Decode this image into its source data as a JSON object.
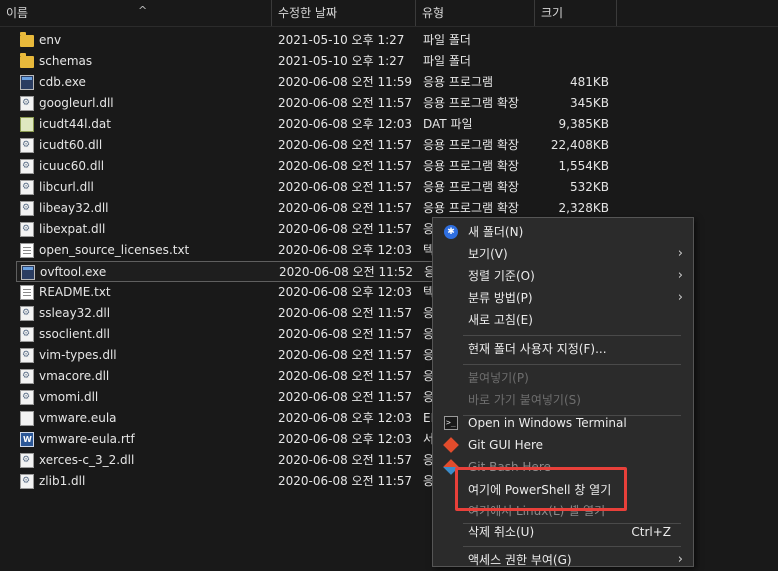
{
  "header": {
    "name": "이름",
    "date": "수정한 날짜",
    "type": "유형",
    "size": "크기",
    "sort_arrow": "^"
  },
  "files": [
    {
      "icon": "folder-icon",
      "kind": "folder",
      "name": "env",
      "date": "2021-05-10 오후 1:27",
      "type": "파일 폴더",
      "size": ""
    },
    {
      "icon": "folder-icon",
      "kind": "folder",
      "name": "schemas",
      "date": "2021-05-10 오후 1:27",
      "type": "파일 폴더",
      "size": ""
    },
    {
      "icon": "exe-icon",
      "kind": "exe",
      "name": "cdb.exe",
      "date": "2020-06-08 오전 11:59",
      "type": "응용 프로그램",
      "size": "481KB"
    },
    {
      "icon": "dll-icon",
      "kind": "dll",
      "name": "googleurl.dll",
      "date": "2020-06-08 오전 11:57",
      "type": "응용 프로그램 확장",
      "size": "345KB"
    },
    {
      "icon": "dat-icon",
      "kind": "dat",
      "name": "icudt44l.dat",
      "date": "2020-06-08 오후 12:03",
      "type": "DAT 파일",
      "size": "9,385KB"
    },
    {
      "icon": "dll-icon",
      "kind": "dll",
      "name": "icudt60.dll",
      "date": "2020-06-08 오전 11:57",
      "type": "응용 프로그램 확장",
      "size": "22,408KB"
    },
    {
      "icon": "dll-icon",
      "kind": "dll",
      "name": "icuuc60.dll",
      "date": "2020-06-08 오전 11:57",
      "type": "응용 프로그램 확장",
      "size": "1,554KB"
    },
    {
      "icon": "dll-icon",
      "kind": "dll",
      "name": "libcurl.dll",
      "date": "2020-06-08 오전 11:57",
      "type": "응용 프로그램 확장",
      "size": "532KB"
    },
    {
      "icon": "dll-icon",
      "kind": "dll",
      "name": "libeay32.dll",
      "date": "2020-06-08 오전 11:57",
      "type": "응용 프로그램 확장",
      "size": "2,328KB"
    },
    {
      "icon": "dll-icon",
      "kind": "dll",
      "name": "libexpat.dll",
      "date": "2020-06-08 오전 11:57",
      "type": "응",
      "size": ""
    },
    {
      "icon": "text-file-icon",
      "kind": "txt",
      "name": "open_source_licenses.txt",
      "date": "2020-06-08 오후 12:03",
      "type": "텍",
      "size": ""
    },
    {
      "icon": "exe-icon",
      "kind": "exe",
      "name": "ovftool.exe",
      "date": "2020-06-08 오전 11:52",
      "type": "응",
      "size": "",
      "selected": true
    },
    {
      "icon": "text-file-icon",
      "kind": "txt",
      "name": "README.txt",
      "date": "2020-06-08 오후 12:03",
      "type": "텍",
      "size": ""
    },
    {
      "icon": "dll-icon",
      "kind": "dll",
      "name": "ssleay32.dll",
      "date": "2020-06-08 오전 11:57",
      "type": "응",
      "size": ""
    },
    {
      "icon": "dll-icon",
      "kind": "dll",
      "name": "ssoclient.dll",
      "date": "2020-06-08 오전 11:57",
      "type": "응",
      "size": ""
    },
    {
      "icon": "dll-icon",
      "kind": "dll",
      "name": "vim-types.dll",
      "date": "2020-06-08 오전 11:57",
      "type": "응",
      "size": ""
    },
    {
      "icon": "dll-icon",
      "kind": "dll",
      "name": "vmacore.dll",
      "date": "2020-06-08 오전 11:57",
      "type": "응",
      "size": ""
    },
    {
      "icon": "dll-icon",
      "kind": "dll",
      "name": "vmomi.dll",
      "date": "2020-06-08 오전 11:57",
      "type": "응",
      "size": ""
    },
    {
      "icon": "file-icon",
      "kind": "file",
      "name": "vmware.eula",
      "date": "2020-06-08 오후 12:03",
      "type": "EL",
      "size": ""
    },
    {
      "icon": "rtf-icon",
      "kind": "rtf",
      "name": "vmware-eula.rtf",
      "date": "2020-06-08 오후 12:03",
      "type": "서",
      "size": ""
    },
    {
      "icon": "dll-icon",
      "kind": "dll",
      "name": "xerces-c_3_2.dll",
      "date": "2020-06-08 오전 11:57",
      "type": "응",
      "size": ""
    },
    {
      "icon": "dll-icon",
      "kind": "dll",
      "name": "zlib1.dll",
      "date": "2020-06-08 오전 11:57",
      "type": "응",
      "size": ""
    }
  ],
  "menu": {
    "new_folder": "새 폴더(N)",
    "view": "보기(V)",
    "sort_by": "정렬 기준(O)",
    "group_by": "분류 방법(P)",
    "refresh": "새로 고침(E)",
    "customize": "현재 폴더 사용자 지정(F)...",
    "paste": "붙여넣기(P)",
    "paste_shortcut": "바로 가기 붙여넣기(S)",
    "terminal": "Open in Windows Terminal",
    "git_gui": "Git GUI Here",
    "git_bash": "Git Bash Here",
    "powershell": "여기에 PowerShell 창 열기",
    "linux_shell": "여기에서 Linux(L) 셸 열기",
    "undo_delete": "삭제 취소(U)",
    "undo_shortcut": "Ctrl+Z",
    "access": "액세스 권한 부여(G)",
    "chevron": "›"
  },
  "colors": {
    "background": "#191919",
    "menu_background": "#2b2b2b",
    "highlight_border": "#e8403a"
  }
}
